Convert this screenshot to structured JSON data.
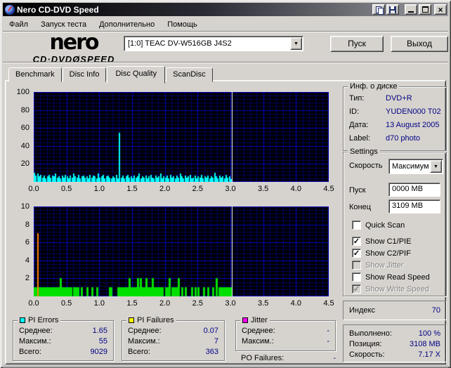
{
  "window": {
    "title": "Nero CD-DVD Speed"
  },
  "menu": {
    "items": [
      "Файл",
      "Запуск теста",
      "Дополнительно",
      "Помощь"
    ]
  },
  "header": {
    "logo_top": "nero",
    "logo_bottom_left": "CD·DVD",
    "logo_disc_glyph": "Ø",
    "logo_bottom_right": "SPEED",
    "drive_selected": "[1:0]   TEAC DV-W516GB J4S2",
    "start_button": "Пуск",
    "exit_button": "Выход"
  },
  "tabs": [
    {
      "label": "Benchmark",
      "active": false
    },
    {
      "label": "Disc Info",
      "active": false
    },
    {
      "label": "Disc Quality",
      "active": true
    },
    {
      "label": "ScanDisc",
      "active": false
    }
  ],
  "disc_info": {
    "title": "Инф. о диске",
    "rows": [
      {
        "label": "Тип:",
        "value": "DVD+R"
      },
      {
        "label": "ID:",
        "value": "YUDEN000 T02"
      },
      {
        "label": "Дата:",
        "value": "13 August 2005"
      },
      {
        "label": "Label:",
        "value": "d70 photo"
      }
    ]
  },
  "settings": {
    "title": "Settings",
    "speed_label": "Скорость",
    "speed_value": "Максимум",
    "start_label": "Пуск",
    "start_value": "0000 MB",
    "end_label": "Конец",
    "end_value": "3109 MB",
    "checkboxes": [
      {
        "label": "Quick Scan",
        "checked": false,
        "disabled": false
      },
      {
        "label": "Show C1/PIE",
        "checked": true,
        "disabled": false
      },
      {
        "label": "Show C2/PIF",
        "checked": true,
        "disabled": false
      },
      {
        "label": "Show Jitter",
        "checked": false,
        "disabled": true
      },
      {
        "label": "Show Read Speed",
        "checked": false,
        "disabled": false
      },
      {
        "label": "Show Write Speed",
        "checked": true,
        "disabled": true
      }
    ]
  },
  "index_panel": {
    "label": "Индекс",
    "value": "70"
  },
  "status_panel": {
    "rows": [
      {
        "label": "Выполнено:",
        "value": "100 %"
      },
      {
        "label": "Позиция:",
        "value": "3108 MB"
      },
      {
        "label": "Скорость:",
        "value": "7.17 X"
      }
    ]
  },
  "stats": {
    "pi_errors": {
      "title": "PI Errors",
      "color": "#00FFFF",
      "rows": [
        {
          "label": "Среднее:",
          "value": "1.65"
        },
        {
          "label": "Максим.:",
          "value": "55"
        },
        {
          "label": "Всего:",
          "value": "9029"
        }
      ]
    },
    "pi_failures": {
      "title": "PI Failures",
      "color": "#FFFF00",
      "rows": [
        {
          "label": "Среднее:",
          "value": "0.07"
        },
        {
          "label": "Максим.:",
          "value": "7"
        },
        {
          "label": "Всего:",
          "value": "363"
        }
      ]
    },
    "jitter": {
      "title": "Jitter",
      "color": "#FF00FF",
      "rows": [
        {
          "label": "Среднее:",
          "value": "-"
        },
        {
          "label": "Максим.:",
          "value": "-"
        }
      ]
    },
    "po_failures": {
      "label": "PO Failures:",
      "value": "-"
    }
  },
  "colors": {
    "value_text": "#000084",
    "grid_major": "#0000C8",
    "grid_minor": "#000063",
    "plot_bg": "#000000",
    "position_line": "#FFFFFF"
  },
  "chart_data": [
    {
      "type": "area",
      "name": "PI Errors (C1/PIE)",
      "color": "#00FFFF",
      "xlim": [
        0,
        4.5
      ],
      "ylim": [
        0,
        100
      ],
      "x_ticks": [
        0.0,
        0.5,
        1.0,
        1.5,
        2.0,
        2.5,
        3.0,
        3.5,
        4.0,
        4.5
      ],
      "y_ticks": [
        20,
        40,
        60,
        80,
        100
      ],
      "x_minor": 0.1,
      "y_minor": 4,
      "position_line_x": 3.02,
      "x_start": 0,
      "x_step": 0.025,
      "values": [
        10,
        7,
        9,
        6,
        8,
        5,
        7,
        4,
        6,
        8,
        5,
        7,
        6,
        9,
        5,
        6,
        4,
        7,
        5,
        8,
        6,
        4,
        7,
        5,
        9,
        6,
        5,
        8,
        4,
        6,
        7,
        5,
        6,
        4,
        8,
        5,
        7,
        6,
        4,
        9,
        5,
        6,
        8,
        4,
        6,
        7,
        5,
        4,
        6,
        5,
        8,
        4,
        55,
        5,
        7,
        4,
        6,
        8,
        5,
        6,
        4,
        7,
        5,
        6,
        9,
        4,
        6,
        5,
        7,
        4,
        6,
        8,
        5,
        4,
        7,
        5,
        6,
        9,
        4,
        6,
        5,
        7,
        4,
        8,
        5,
        6,
        4,
        7,
        5,
        9,
        6,
        4,
        7,
        5,
        6,
        8,
        4,
        5,
        7,
        4,
        6,
        5,
        8,
        4,
        6,
        5,
        7,
        4,
        6,
        5,
        10,
        6,
        4,
        7,
        5,
        6,
        4,
        8,
        5,
        6,
        3
      ],
      "peak": {
        "x": 1.3,
        "y": 55
      }
    },
    {
      "type": "bar",
      "name": "PI Failures (C2/PIF)",
      "bar_color": "#00E000",
      "spike": {
        "x": 0.05,
        "y": 7,
        "color": "#FF8000"
      },
      "xlim": [
        0,
        4.5
      ],
      "ylim": [
        0,
        10
      ],
      "x_ticks": [
        0.0,
        0.5,
        1.0,
        1.5,
        2.0,
        2.5,
        3.0,
        3.5,
        4.0,
        4.5
      ],
      "y_ticks": [
        2,
        4,
        6,
        8,
        10
      ],
      "x_minor": 0.1,
      "y_minor": 0.4,
      "position_line_x": 3.02,
      "bars": [
        [
          0.0,
          1
        ],
        [
          0.01,
          1
        ],
        [
          0.02,
          1
        ],
        [
          0.03,
          1
        ],
        [
          0.04,
          1
        ],
        [
          0.05,
          1
        ],
        [
          0.06,
          1
        ],
        [
          0.07,
          1
        ],
        [
          0.08,
          1
        ],
        [
          0.09,
          1
        ],
        [
          0.1,
          1
        ],
        [
          0.11,
          1
        ],
        [
          0.12,
          1
        ],
        [
          0.13,
          1
        ],
        [
          0.14,
          1
        ],
        [
          0.15,
          1
        ],
        [
          0.16,
          1
        ],
        [
          0.17,
          1
        ],
        [
          0.2,
          1
        ],
        [
          0.21,
          1
        ],
        [
          0.22,
          1
        ],
        [
          0.23,
          1
        ],
        [
          0.24,
          1
        ],
        [
          0.25,
          1
        ],
        [
          0.26,
          1
        ],
        [
          0.27,
          1
        ],
        [
          0.3,
          1
        ],
        [
          0.32,
          1
        ],
        [
          0.34,
          1
        ],
        [
          0.36,
          1
        ],
        [
          0.38,
          1
        ],
        [
          0.4,
          2
        ],
        [
          0.42,
          1
        ],
        [
          0.44,
          1
        ],
        [
          0.47,
          1
        ],
        [
          0.5,
          1
        ],
        [
          0.53,
          1
        ],
        [
          0.56,
          1
        ],
        [
          0.6,
          1
        ],
        [
          0.63,
          1
        ],
        [
          0.66,
          1
        ],
        [
          0.72,
          1
        ],
        [
          0.8,
          1
        ],
        [
          0.88,
          1
        ],
        [
          0.95,
          1
        ],
        [
          1.15,
          1
        ],
        [
          1.17,
          1
        ],
        [
          1.28,
          1
        ],
        [
          1.3,
          1
        ],
        [
          1.33,
          1
        ],
        [
          1.35,
          1
        ],
        [
          1.38,
          1
        ],
        [
          1.4,
          1
        ],
        [
          1.42,
          1
        ],
        [
          1.45,
          2
        ],
        [
          1.47,
          1
        ],
        [
          1.5,
          1
        ],
        [
          1.52,
          1
        ],
        [
          1.55,
          1
        ],
        [
          1.57,
          2
        ],
        [
          1.6,
          1
        ],
        [
          1.62,
          2
        ],
        [
          1.65,
          1
        ],
        [
          1.67,
          1
        ],
        [
          1.7,
          2
        ],
        [
          1.73,
          1
        ],
        [
          1.75,
          1
        ],
        [
          1.78,
          1
        ],
        [
          1.8,
          2
        ],
        [
          1.83,
          1
        ],
        [
          1.85,
          1
        ],
        [
          1.88,
          1
        ],
        [
          1.9,
          1
        ],
        [
          1.93,
          1
        ],
        [
          1.95,
          1
        ],
        [
          2.0,
          1
        ],
        [
          2.03,
          1
        ],
        [
          2.06,
          2
        ],
        [
          2.1,
          1
        ],
        [
          2.13,
          1
        ],
        [
          2.16,
          1
        ],
        [
          2.2,
          2
        ],
        [
          2.25,
          1
        ],
        [
          2.3,
          1
        ],
        [
          2.4,
          1
        ],
        [
          2.45,
          1
        ],
        [
          2.5,
          1
        ],
        [
          2.58,
          1
        ],
        [
          2.65,
          1
        ],
        [
          2.72,
          1
        ],
        [
          2.78,
          2
        ],
        [
          2.82,
          1
        ],
        [
          2.85,
          1
        ],
        [
          2.88,
          1
        ],
        [
          2.91,
          1
        ],
        [
          2.94,
          1
        ],
        [
          2.97,
          1
        ],
        [
          3.0,
          1
        ]
      ]
    }
  ]
}
